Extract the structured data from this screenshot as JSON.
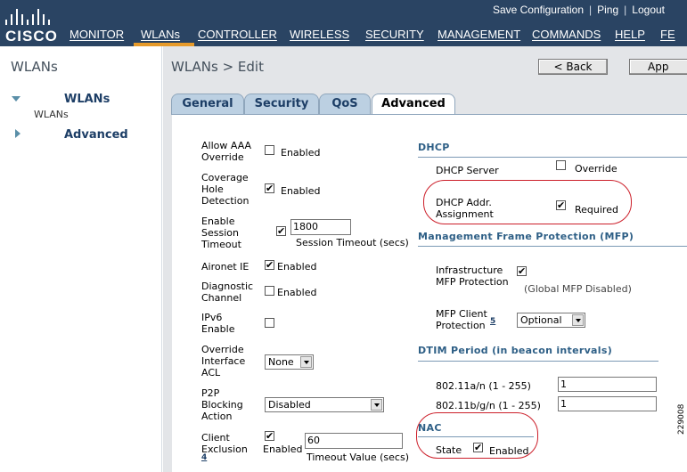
{
  "header": {
    "logo_text": "CISCO",
    "links": {
      "save": "Save Configuration",
      "ping": "Ping",
      "logout": "Logout"
    },
    "nav": [
      "MONITOR",
      "WLANs",
      "CONTROLLER",
      "WIRELESS",
      "SECURITY",
      "MANAGEMENT",
      "COMMANDS",
      "HELP",
      "FE"
    ],
    "active_nav": "WLANs"
  },
  "sidebar": {
    "title": "WLANs",
    "items": [
      {
        "label": "WLANs",
        "sub": "WLANs",
        "expanded": true
      },
      {
        "label": "Advanced",
        "expanded": false
      }
    ]
  },
  "main": {
    "breadcrumb": "WLANs > Edit",
    "buttons": {
      "back": "< Back",
      "apply": "App"
    },
    "tabs": [
      "General",
      "Security",
      "QoS",
      "Advanced"
    ],
    "active_tab": "Advanced"
  },
  "left": {
    "allow_aaa": {
      "label": "Allow AAA Override",
      "checked": false,
      "text": "Enabled"
    },
    "coverage": {
      "label": "Coverage Hole Detection",
      "checked": true,
      "text": "Enabled"
    },
    "session": {
      "label": "Enable Session Timeout",
      "checked": true,
      "value": "1800",
      "caption": "Session Timeout (secs)"
    },
    "aironet": {
      "label": "Aironet IE",
      "checked": true,
      "text": "Enabled"
    },
    "diagnostic": {
      "label": "Diagnostic Channel",
      "checked": false,
      "text": "Enabled"
    },
    "ipv6": {
      "label": "IPv6 Enable",
      "checked": false
    },
    "override_acl": {
      "label": "Override Interface ACL",
      "value": "None"
    },
    "p2p": {
      "label": "P2P Blocking Action",
      "value": "Disabled"
    },
    "client_excl": {
      "label": "Client Exclusion",
      "link_num": "4",
      "checked": true,
      "text": "Enabled",
      "value": "60",
      "caption": "Timeout Value (secs)"
    }
  },
  "right": {
    "dhcp": {
      "title": "DHCP",
      "server": {
        "label": "DHCP Server",
        "checked": false,
        "text": "Override"
      },
      "addr": {
        "label": "DHCP Addr. Assignment",
        "checked": true,
        "text": "Required"
      }
    },
    "mfp": {
      "title": "Management Frame Protection (MFP)",
      "infra": {
        "label": "Infrastructure MFP Protection",
        "checked": true,
        "note": "(Global MFP Disabled)"
      },
      "client": {
        "label": "MFP Client Protection",
        "link_num": "5",
        "value": "Optional"
      }
    },
    "dtim": {
      "title": "DTIM Period (in beacon intervals)",
      "a": {
        "label": "802.11a/n (1 - 255)",
        "value": "1"
      },
      "bg": {
        "label": "802.11b/g/n (1 - 255)",
        "value": "1"
      }
    },
    "nac": {
      "title": "NAC",
      "state": {
        "label": "State",
        "checked": true,
        "text": "Enabled"
      }
    }
  },
  "figure_number": "229008",
  "colors": {
    "header": "#2a4463",
    "active_underline": "#e69a2a",
    "tab": "#bcd0e2",
    "section_title": "#2e5f86",
    "highlight_oval": "#cc1f2a"
  }
}
